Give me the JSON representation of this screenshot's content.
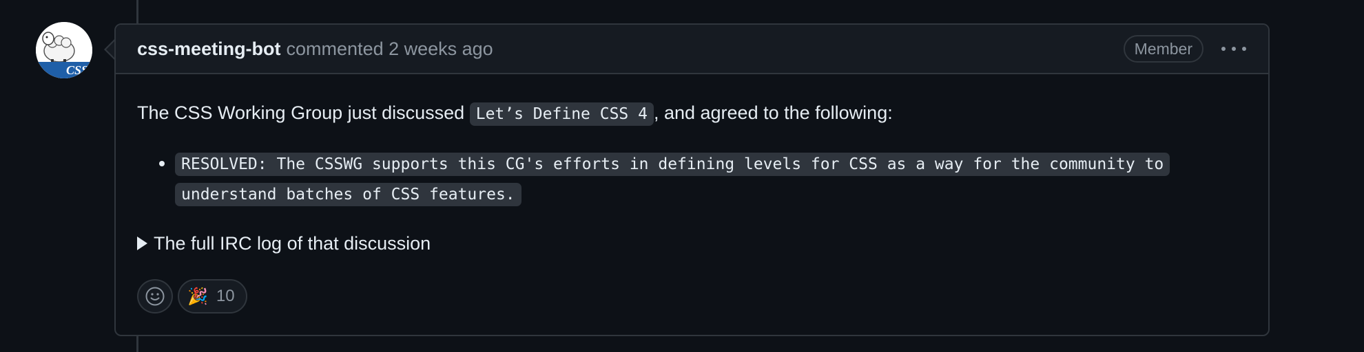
{
  "comment": {
    "author": "css-meeting-bot",
    "meta": "commented 2 weeks ago",
    "badge": "Member",
    "body": {
      "intro_before": "The CSS Working Group just discussed ",
      "intro_code": "Let’s Define CSS 4",
      "intro_after": ", and agreed to the following:",
      "resolutions": [
        "RESOLVED: The CSSWG supports this CG's efforts in defining levels for CSS as a way for the community to understand batches of CSS features."
      ],
      "details_summary": "The full IRC log of that discussion"
    },
    "reactions": {
      "add_reaction_icon": "smiley-icon",
      "items": [
        {
          "emoji": "🎉",
          "icon": "party-popper-icon",
          "count": "10"
        }
      ]
    },
    "avatar": {
      "logo_text": "CSS"
    }
  },
  "colors": {
    "background": "#0d1117",
    "header": "#161b22",
    "border": "#30363d",
    "muted": "#8d96a0",
    "text": "#e6edf3",
    "code_bg": "#2f353d"
  }
}
